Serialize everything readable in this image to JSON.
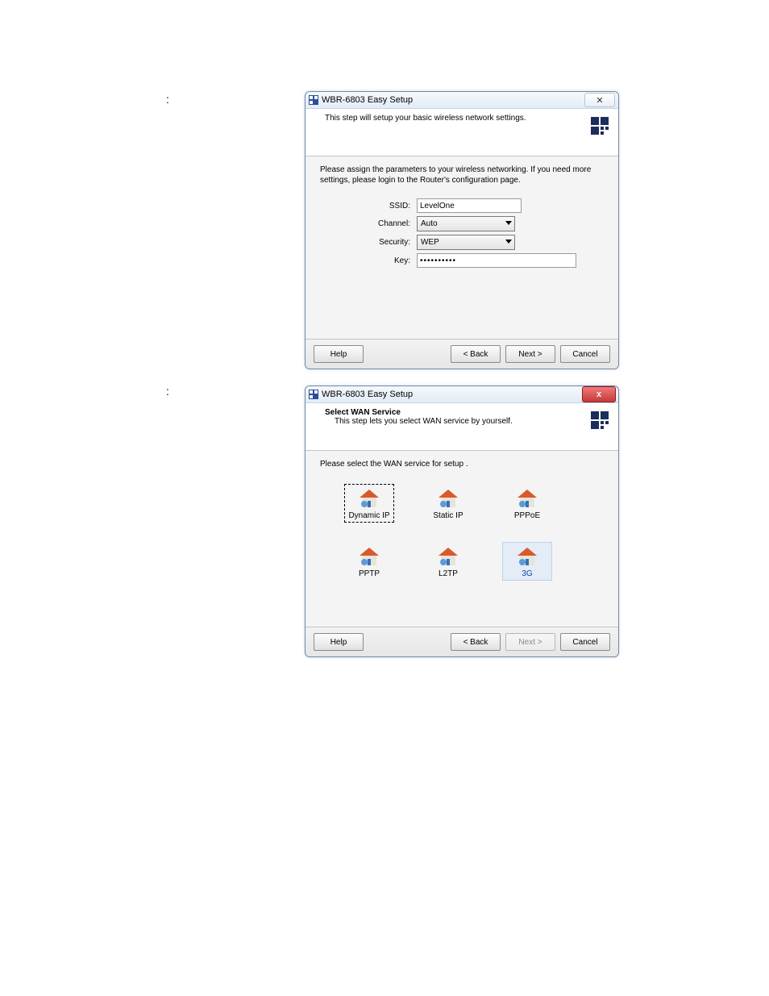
{
  "window1": {
    "title": "WBR-6803 Easy Setup",
    "close_symbol": "✕",
    "heading": "This step will setup your basic wireless network settings.",
    "instruction": "Please assign the parameters to your wireless networking. If you need more settings, please login to the Router's configuration page.",
    "fields": {
      "ssid_label": "SSID:",
      "ssid_value": "LevelOne",
      "channel_label": "Channel:",
      "channel_value": "Auto",
      "security_label": "Security:",
      "security_value": "WEP",
      "key_label": "Key:",
      "key_value": "••••••••••"
    },
    "buttons": {
      "help": "Help",
      "back": "< Back",
      "next": "Next >",
      "cancel": "Cancel"
    }
  },
  "window2": {
    "title": "WBR-6803 Easy Setup",
    "close_symbol": "x",
    "heading_bold": "Select WAN Service",
    "heading_sub": "This step lets you select WAN service by yourself.",
    "instruction": "Please select the WAN service for setup .",
    "services": {
      "dynamic_ip": "Dynamic IP",
      "static_ip": "Static IP",
      "pppoe": "PPPoE",
      "pptp": "PPTP",
      "l2tp": "L2TP",
      "threeg": "3G"
    },
    "buttons": {
      "help": "Help",
      "back": "< Back",
      "next": "Next >",
      "cancel": "Cancel"
    }
  },
  "colons": {
    "a": ":",
    "b": ":"
  }
}
